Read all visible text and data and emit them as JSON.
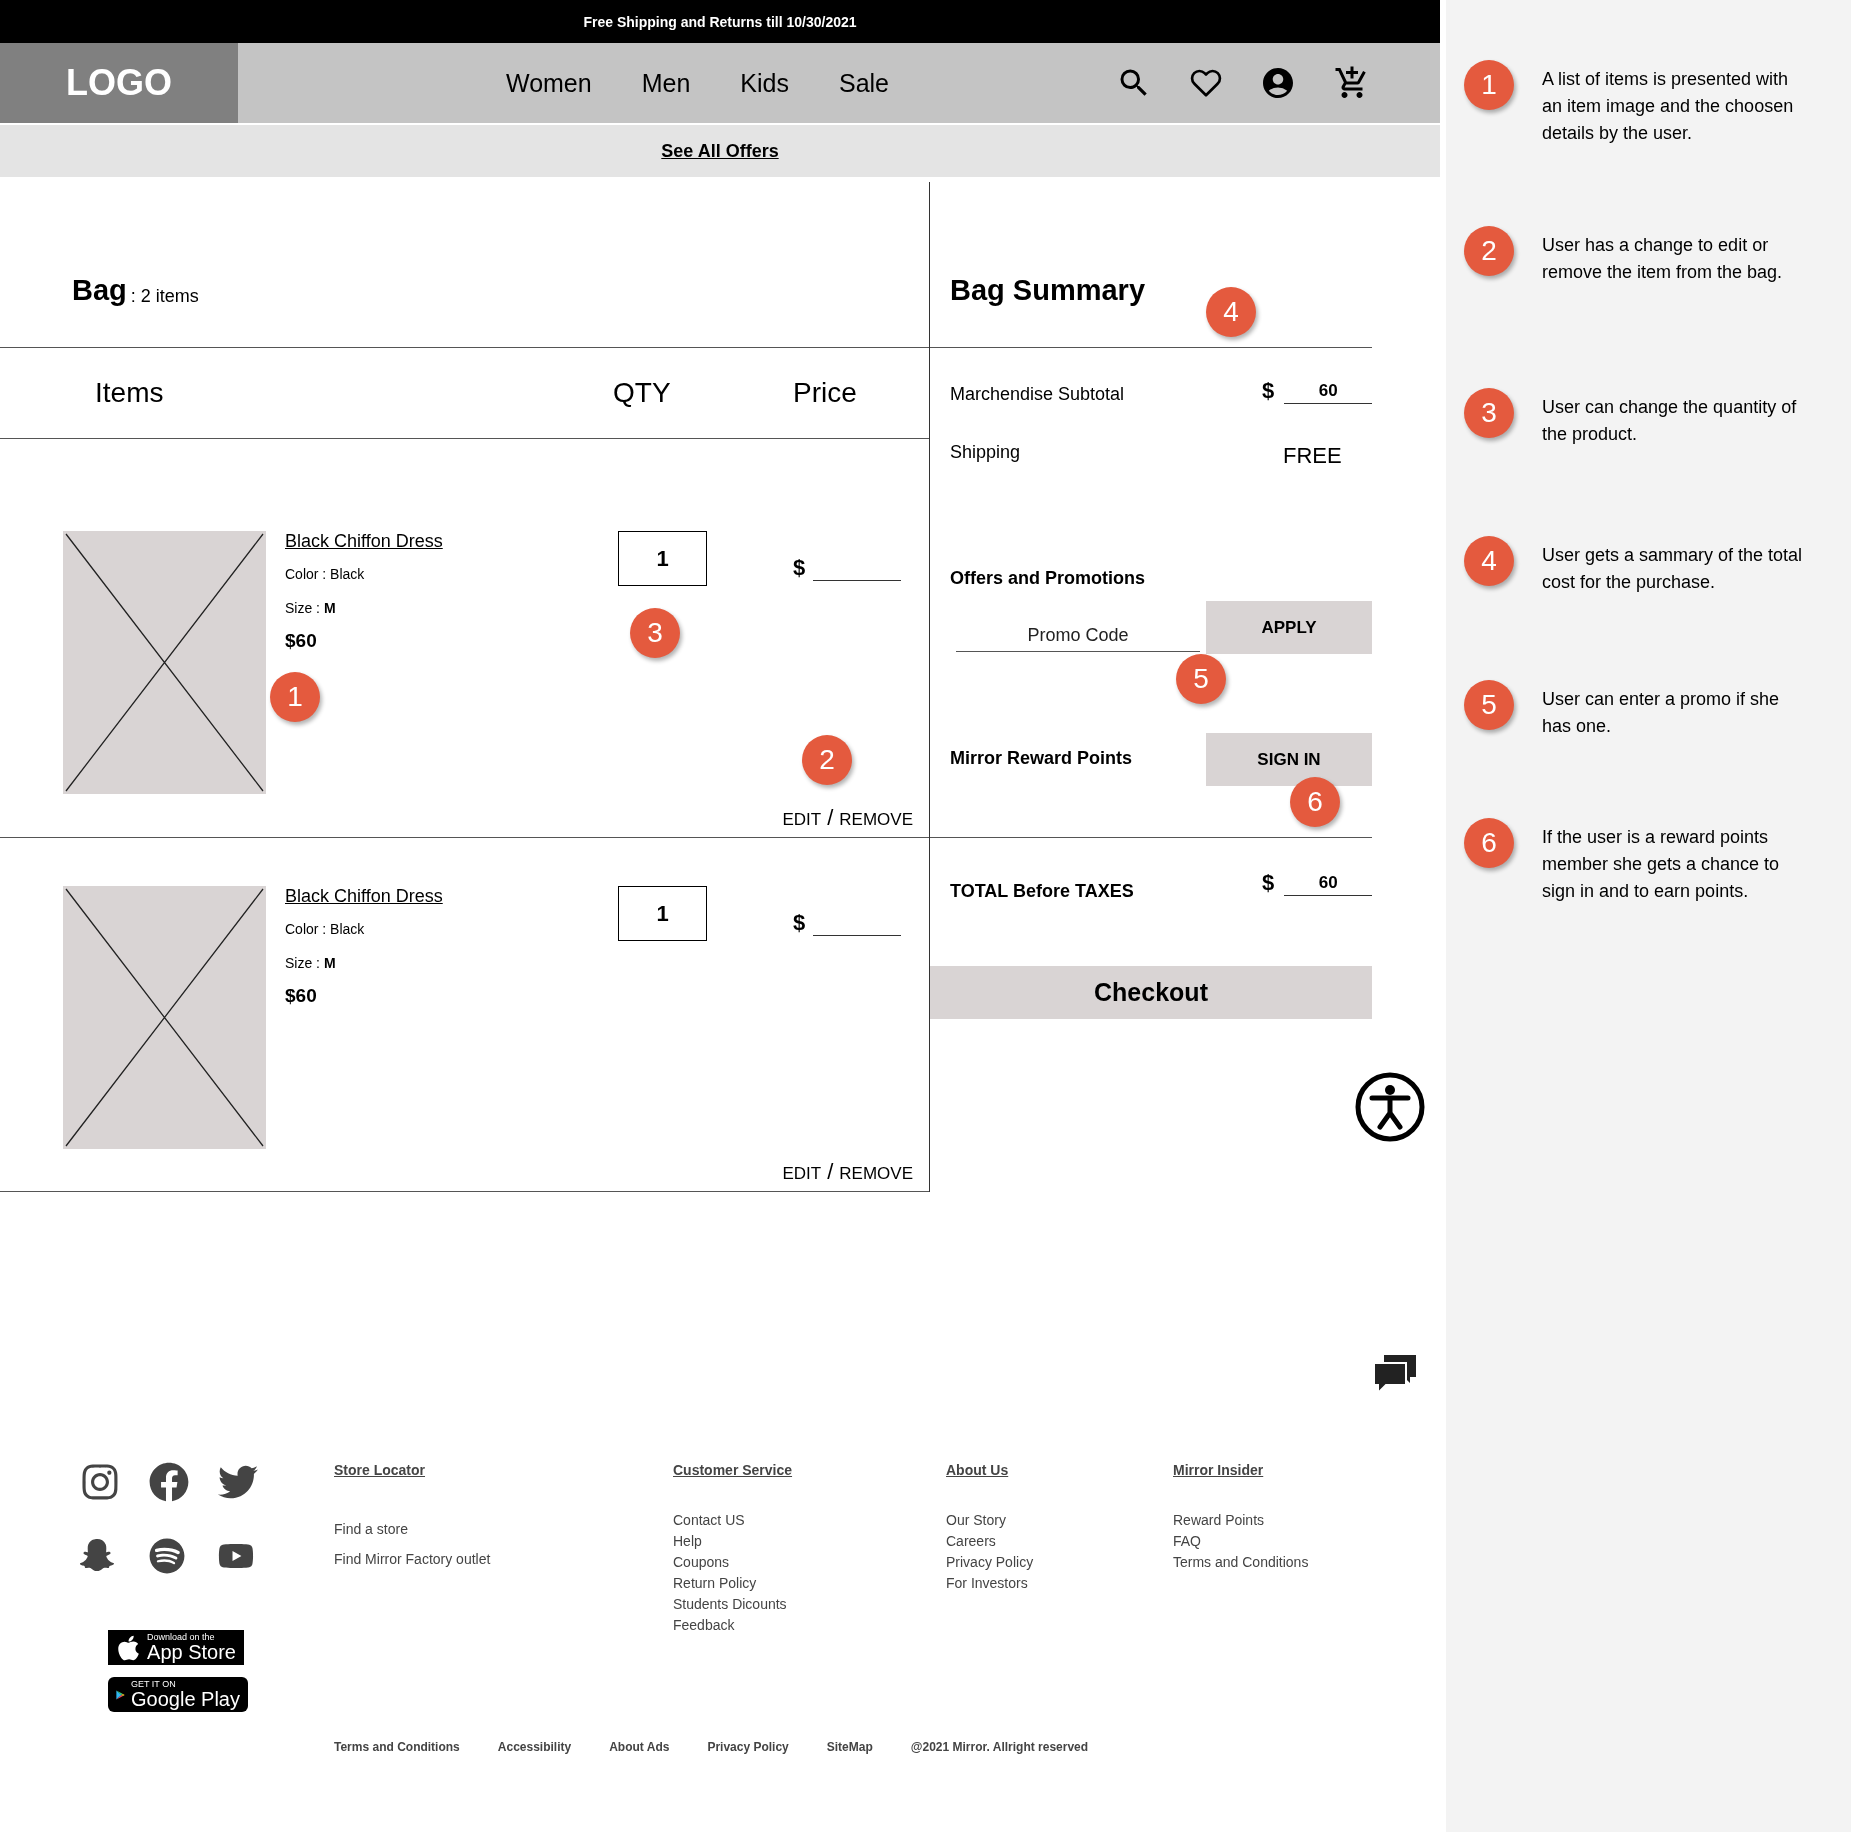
{
  "promo_bar": {
    "text": "Free Shipping and Returns till 10/30/2021"
  },
  "header": {
    "logo": "LOGO",
    "nav": [
      "Women",
      "Men",
      "Kids",
      "Sale"
    ]
  },
  "offers_link": "See All Offers",
  "bag": {
    "title": "Bag",
    "count": ": 2 items",
    "columns": [
      "Items",
      "QTY",
      "Price"
    ],
    "items": [
      {
        "name": "Black Chiffon Dress",
        "color_text": "Color : Black",
        "size": "Size : **M**",
        "price": "$60",
        "qty": "1",
        "currency": "$",
        "edit": "EDIT",
        "separator": "/",
        "remove": "REMOVE"
      },
      {
        "name": "Black Chiffon Dress",
        "color_text": "Color : Black",
        "size": "Size : **M**",
        "price": "$60",
        "qty": "1",
        "currency": "$",
        "edit": "EDIT",
        "separator": "/",
        "remove": "REMOVE"
      }
    ]
  },
  "summary": {
    "title": "Bag Summary",
    "subtotal": {
      "label": "Marchendise Subtotal",
      "currency": "$",
      "value": "60"
    },
    "shipping": {
      "label": "Shipping",
      "value": "FREE"
    },
    "offers": {
      "title": "Offers and Promotions",
      "placeholder": "Promo Code",
      "button": "APPLY"
    },
    "rewards": {
      "label": "Mirror Reward Points",
      "button": "SIGN IN"
    },
    "total": {
      "label": "TOTAL Before TAXES",
      "currency": "$",
      "value": "60"
    },
    "checkout": "Checkout"
  },
  "markers": [
    "1",
    "3",
    "2",
    "4",
    "5",
    "6"
  ],
  "notes": [
    {
      "number": "1",
      "text": "A list of items is presented with an item image and the choosen details by the user."
    },
    {
      "number": "2",
      "text": "User has a change to edit or remove the item from the bag."
    },
    {
      "number": "3",
      "text": "User can change the quantity of the product."
    },
    {
      "number": "4",
      "text": "User gets a sammary of the total cost for the purchase."
    },
    {
      "number": "5",
      "text": "User can enter a promo if she has one."
    },
    {
      "number": "6",
      "text": "If the user is a reward points member she gets a chance to sign in and to earn points."
    }
  ],
  "footer": {
    "apps": [
      {
        "small": "Download on the",
        "big": "App Store"
      },
      {
        "small": "GET IT ON",
        "big": "Google Play"
      }
    ],
    "columns": [
      {
        "heading": "Store Locator",
        "links": [
          "Find a store",
          "Find Mirror Factory outlet"
        ]
      },
      {
        "heading": "Customer Service",
        "links": [
          "Contact US",
          "Help",
          "Coupons",
          "Return Policy",
          "Students Dicounts",
          "Feedback"
        ]
      },
      {
        "heading": "About Us",
        "links": [
          "Our Story",
          "Careers",
          "Privacy Policy",
          "For Investors"
        ]
      },
      {
        "heading": "Mirror Insider",
        "links": [
          "Reward Points",
          "FAQ",
          "Terms and Conditions"
        ]
      }
    ],
    "bottom_links": [
      "Terms and Conditions",
      "Accessibility",
      "About Ads",
      "Privacy Policy",
      "SiteMap",
      "@2021 Mirror. Allright reserved"
    ]
  }
}
